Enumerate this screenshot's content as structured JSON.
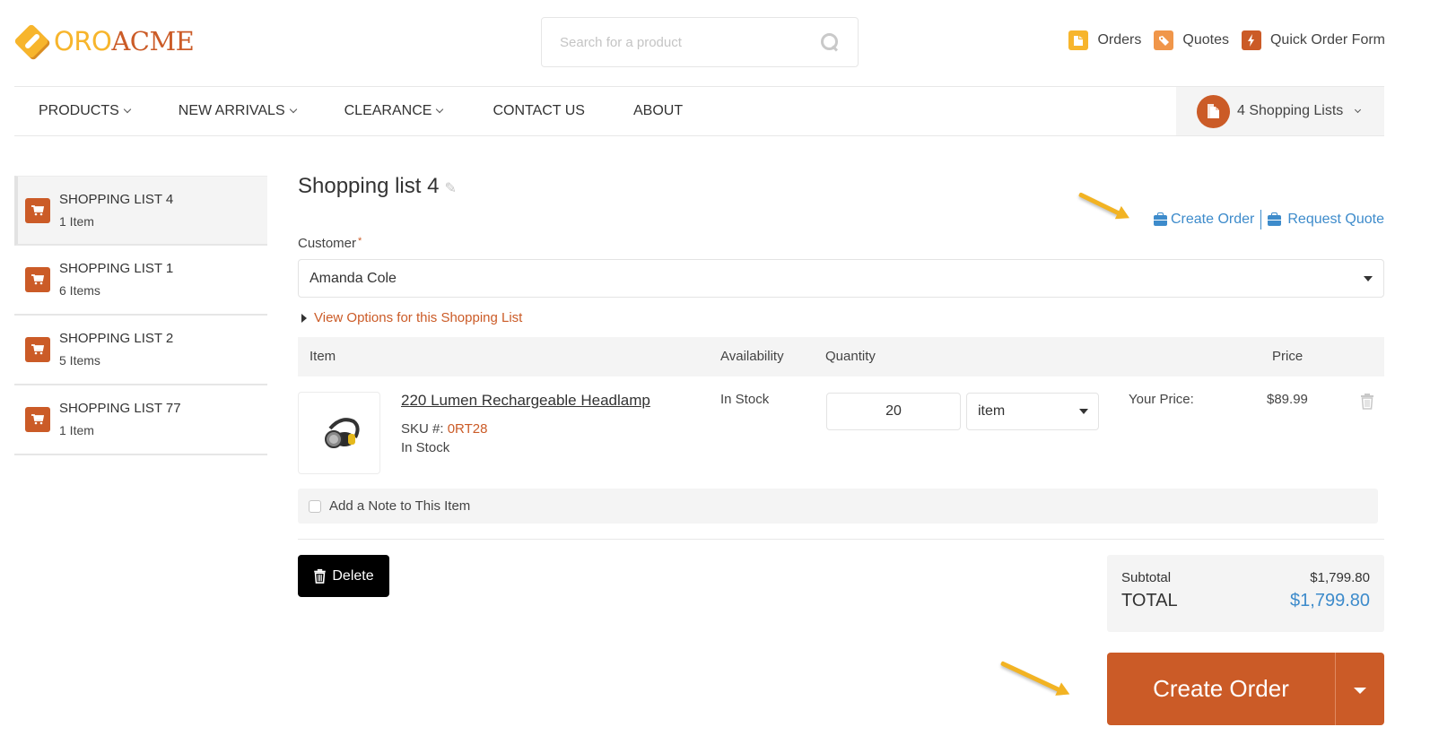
{
  "header": {
    "logo": {
      "part1": "ORO",
      "part2": "ACME"
    },
    "search": {
      "placeholder": "Search for a product",
      "value": ""
    },
    "top_links": [
      {
        "label": "Orders",
        "icon": "orders-icon",
        "color": "#f7b52c"
      },
      {
        "label": "Quotes",
        "icon": "tag-icon",
        "color": "#f0964a"
      },
      {
        "label": "Quick Order Form",
        "icon": "bolt-icon",
        "color": "#cb5b27"
      }
    ]
  },
  "nav": {
    "items": [
      {
        "label": "PRODUCTS",
        "dropdown": true
      },
      {
        "label": "NEW ARRIVALS",
        "dropdown": true
      },
      {
        "label": "CLEARANCE",
        "dropdown": true
      },
      {
        "label": "CONTACT US",
        "dropdown": false
      },
      {
        "label": "ABOUT",
        "dropdown": false
      }
    ],
    "shopping_lists_widget": {
      "label": "4 Shopping Lists"
    }
  },
  "sidebar": {
    "items": [
      {
        "title": "SHOPPING LIST 4",
        "count": "1 Item",
        "active": true
      },
      {
        "title": "SHOPPING LIST 1",
        "count": "6 Items",
        "active": false
      },
      {
        "title": "SHOPPING LIST 2",
        "count": "5 Items",
        "active": false
      },
      {
        "title": "SHOPPING LIST 77",
        "count": "1 Item",
        "active": false
      }
    ]
  },
  "main": {
    "title": "Shopping list 4",
    "actions": {
      "create_order": "Create Order",
      "request_quote": "Request Quote"
    },
    "customer": {
      "label": "Customer",
      "required_mark": "*",
      "value": "Amanda Cole"
    },
    "view_options": "View Options for this Shopping List",
    "table": {
      "headers": {
        "item": "Item",
        "availability": "Availability",
        "quantity": "Quantity",
        "price": "Price"
      },
      "rows": [
        {
          "name": "220 Lumen Rechargeable Headlamp",
          "sku_label": "SKU #:",
          "sku": "0RT28",
          "stock_status": "In Stock",
          "availability": "In Stock",
          "quantity": "20",
          "unit": "item",
          "price_label": "Your Price:",
          "price": "$89.99"
        }
      ]
    },
    "note_label": "Add a Note to This Item",
    "delete_label": "Delete",
    "totals": {
      "subtotal_label": "Subtotal",
      "subtotal": "$1,799.80",
      "total_label": "TOTAL",
      "total": "$1,799.80"
    },
    "create_order_button": "Create Order"
  },
  "colors": {
    "brand_primary": "#cb5b27",
    "brand_yellow": "#f7b52c",
    "link_blue": "#3d8bcb",
    "annotation_arrow": "#f2b323"
  }
}
